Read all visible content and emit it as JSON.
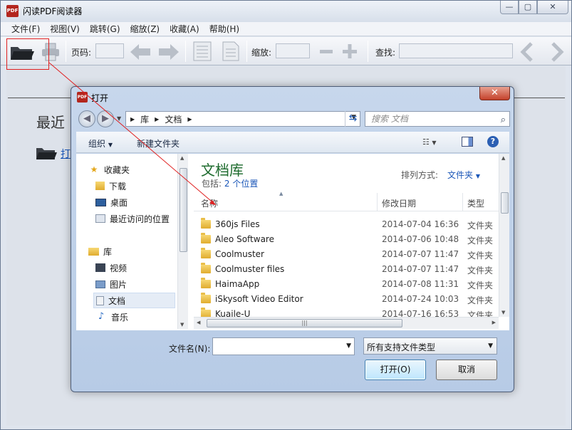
{
  "app": {
    "title": "闪读PDF阅读器",
    "icon_text": "PDF",
    "window_buttons": {
      "minimize": "—",
      "maximize": "▢",
      "close": "✕"
    }
  },
  "menu": [
    "文件(F)",
    "视图(V)",
    "跳转(G)",
    "缩放(Z)",
    "收藏(A)",
    "帮助(H)"
  ],
  "toolbar": {
    "page_label": "页码:",
    "zoom_label": "缩放:",
    "find_label": "查找:"
  },
  "start_page": {
    "recent_title": "最近",
    "open_link": "打"
  },
  "dialog": {
    "title": "打开",
    "icon_text": "PDF",
    "close": "✕",
    "breadcrumb": [
      "库",
      "文档"
    ],
    "search_placeholder": "搜索 文档",
    "organize": "组织",
    "new_folder": "新建文件夹",
    "nav": {
      "favorites": "收藏夹",
      "downloads": "下载",
      "desktop": "桌面",
      "recent_places": "最近访问的位置",
      "libraries": "库",
      "videos": "视频",
      "pictures": "图片",
      "documents": "文档",
      "music": "音乐"
    },
    "library_title": "文档库",
    "library_includes": "包括:",
    "library_locations": "2 个位置",
    "arrange_label": "排列方式:",
    "arrange_value": "文件夹",
    "columns": {
      "name": "名称",
      "modified": "修改日期",
      "type": "类型"
    },
    "files": [
      {
        "name": "360js Files",
        "date": "2014-07-04 16:36",
        "type": "文件夹"
      },
      {
        "name": "Aleo Software",
        "date": "2014-07-06 10:48",
        "type": "文件夹"
      },
      {
        "name": "Coolmuster",
        "date": "2014-07-07 11:47",
        "type": "文件夹"
      },
      {
        "name": "Coolmuster files",
        "date": "2014-07-07 11:47",
        "type": "文件夹"
      },
      {
        "name": "HaimaApp",
        "date": "2014-07-08 11:31",
        "type": "文件夹"
      },
      {
        "name": "iSkysoft Video Editor",
        "date": "2014-07-24 10:03",
        "type": "文件夹"
      },
      {
        "name": "Kuaile-U",
        "date": "2014-07-16 16:53",
        "type": "文件夹"
      }
    ],
    "filename_label": "文件名(N):",
    "filename_value": "",
    "filetype_value": "所有支持文件类型",
    "open_button": "打开(O)",
    "cancel_button": "取消"
  }
}
